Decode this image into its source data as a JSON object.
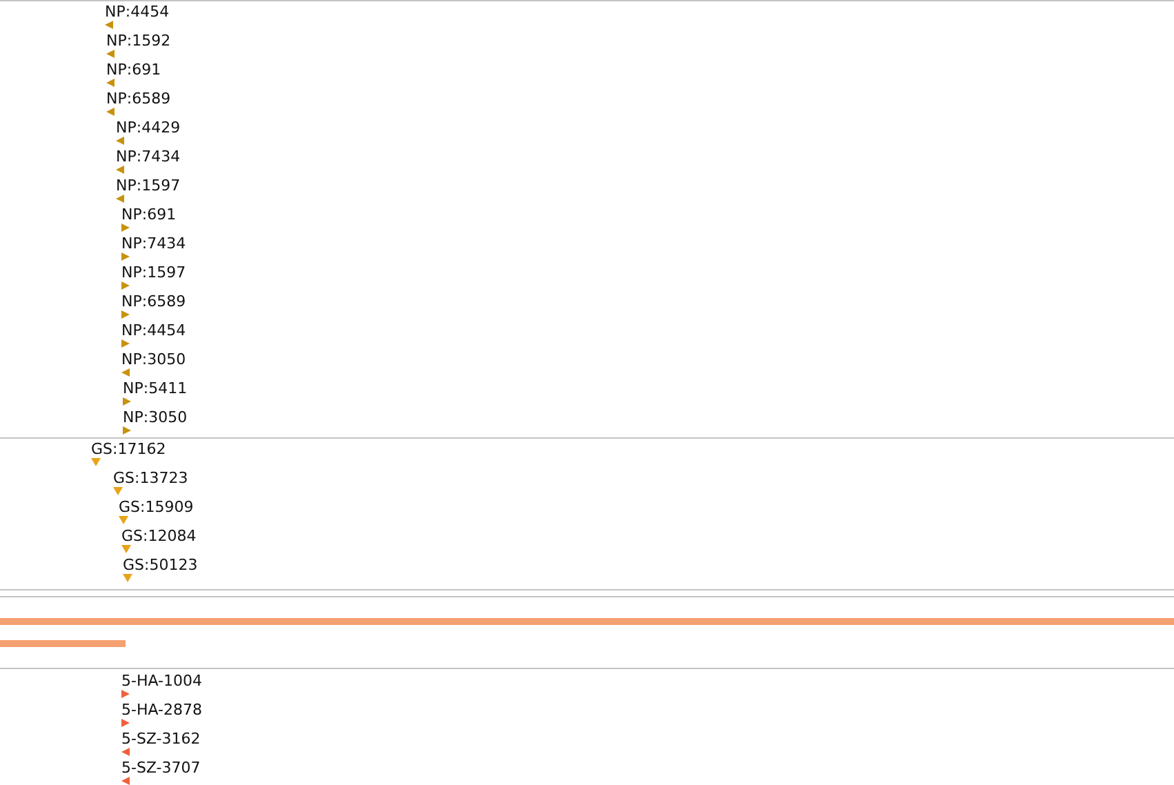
{
  "tracks": [
    {
      "color": "#c8920e",
      "features": [
        {
          "label": "NP:4454",
          "kind": "left"
        },
        {
          "label": "NP:1592",
          "kind": "left"
        },
        {
          "label": "NP:691",
          "kind": "left"
        },
        {
          "label": "NP:6589",
          "kind": "left"
        },
        {
          "label": "NP:4429",
          "kind": "left"
        },
        {
          "label": "NP:7434",
          "kind": "left"
        },
        {
          "label": "NP:1597",
          "kind": "left"
        },
        {
          "label": "NP:691",
          "kind": "right"
        },
        {
          "label": "NP:7434",
          "kind": "right"
        },
        {
          "label": "NP:1597",
          "kind": "right"
        },
        {
          "label": "NP:6589",
          "kind": "right"
        },
        {
          "label": "NP:4454",
          "kind": "right"
        },
        {
          "label": "NP:3050",
          "kind": "left"
        },
        {
          "label": "NP:5411",
          "kind": "right"
        },
        {
          "label": "NP:3050",
          "kind": "right"
        }
      ]
    },
    {
      "color": "#e8a418",
      "features": [
        {
          "label": "GS:17162",
          "kind": "down"
        },
        {
          "label": "GS:13723",
          "kind": "down"
        },
        {
          "label": "GS:15909",
          "kind": "down"
        },
        {
          "label": "GS:12084",
          "kind": "down"
        },
        {
          "label": "GS:50123",
          "kind": "down"
        }
      ]
    },
    {
      "color": "#f0603c",
      "features": [
        {
          "label": "5-HA-1004",
          "kind": "right"
        },
        {
          "label": "5-HA-2878",
          "kind": "right"
        },
        {
          "label": "5-SZ-3162",
          "kind": "left"
        },
        {
          "label": "5-SZ-3707",
          "kind": "left"
        }
      ]
    }
  ]
}
